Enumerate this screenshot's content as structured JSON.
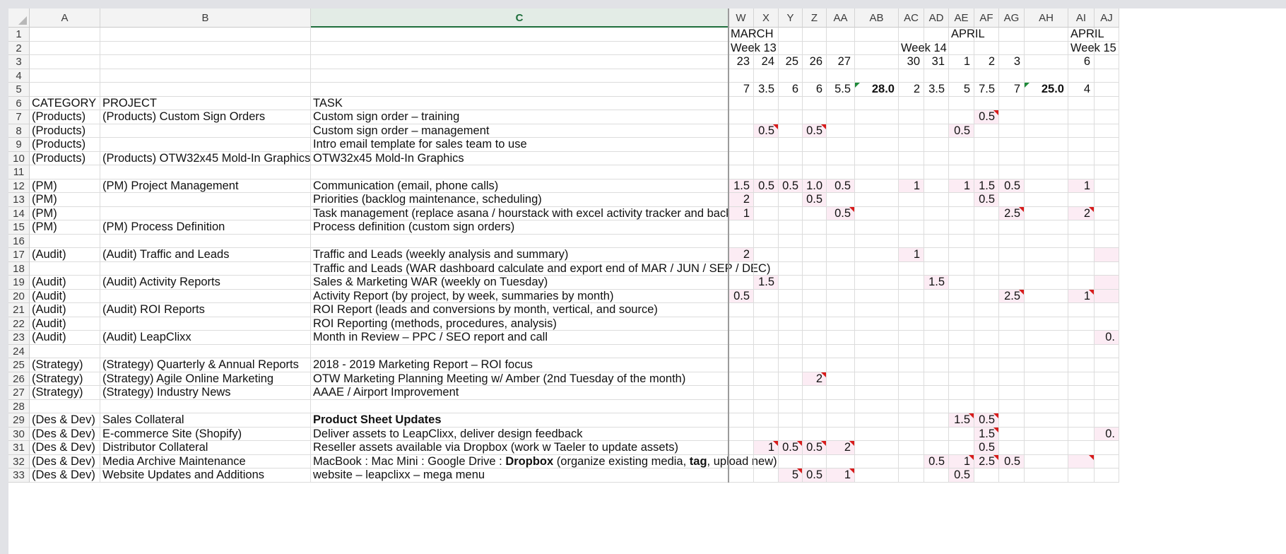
{
  "columns": [
    "A",
    "B",
    "C",
    "W",
    "X",
    "Y",
    "Z",
    "AA",
    "AB",
    "AC",
    "AD",
    "AE",
    "AF",
    "AG",
    "AH",
    "AI",
    "AJ"
  ],
  "selected_column": "C",
  "rows": [
    {
      "n": "1",
      "cells": {
        "W": "MARCH",
        "AE": "APRIL",
        "AI": "APRIL"
      }
    },
    {
      "n": "2",
      "cells": {
        "W": "Week 13",
        "AC": "Week 14",
        "AI": "Week 15"
      }
    },
    {
      "n": "3",
      "cells": {
        "W": "23",
        "X": "24",
        "Y": "25",
        "Z": "26",
        "AA": "27",
        "AC": "30",
        "AD": "31",
        "AE": "1",
        "AF": "2",
        "AG": "3",
        "AI": "6"
      }
    },
    {
      "n": "4",
      "cells": {}
    },
    {
      "n": "5",
      "cells": {
        "W": "7",
        "X": "3.5",
        "Y": "6",
        "Z": "6",
        "AA": "5.5",
        "AB": "28.0",
        "AC": "2",
        "AD": "3.5",
        "AE": "5",
        "AF": "7.5",
        "AG": "7",
        "AH": "25.0",
        "AI": "4"
      }
    },
    {
      "n": "6",
      "cells": {
        "A": "CATEGORY",
        "B": "PROJECT",
        "C": "TASK"
      }
    },
    {
      "n": "7",
      "cells": {
        "A": "(Products)",
        "B": "(Products) Custom Sign Orders",
        "C": "Custom sign order – training",
        "AF": "0.5"
      }
    },
    {
      "n": "8",
      "cells": {
        "A": "(Products)",
        "C": "Custom sign order – management",
        "X": "0.5",
        "Z": "0.5",
        "AE": "0.5"
      }
    },
    {
      "n": "9",
      "cells": {
        "A": "(Products)",
        "C": "Intro email template for sales team to use"
      }
    },
    {
      "n": "10",
      "cells": {
        "A": "(Products)",
        "B": "(Products) OTW32x45 Mold-In Graphics",
        "C": "OTW32x45 Mold-In Graphics"
      }
    },
    {
      "n": "11",
      "cells": {}
    },
    {
      "n": "12",
      "cells": {
        "A": "(PM)",
        "B": "(PM) Project Management",
        "C": "Communication (email, phone calls)",
        "W": "1.5",
        "X": "0.5",
        "Y": "0.5",
        "Z": "1.0",
        "AA": "0.5",
        "AC": "1",
        "AE": "1",
        "AF": "1.5",
        "AG": "0.5",
        "AI": "1"
      }
    },
    {
      "n": "13",
      "cells": {
        "A": "(PM)",
        "C": "Priorities (backlog maintenance, scheduling)",
        "W": "2",
        "Z": "0.5",
        "AF": "0.5"
      }
    },
    {
      "n": "14",
      "cells": {
        "A": "(PM)",
        "C": "Task management (replace asana / hourstack with excel activity tracker and backlog )",
        "W": "1",
        "AA": "0.5",
        "AG": "2.5",
        "AI": "2"
      }
    },
    {
      "n": "15",
      "cells": {
        "A": "(PM)",
        "B": "(PM) Process Definition",
        "C": "Process definition (custom sign orders)"
      }
    },
    {
      "n": "16",
      "cells": {}
    },
    {
      "n": "17",
      "cells": {
        "A": "(Audit)",
        "B": "(Audit) Traffic and Leads",
        "C": "Traffic and Leads (weekly analysis and summary)",
        "W": "2",
        "AC": "1"
      }
    },
    {
      "n": "18",
      "cells": {
        "C": "Traffic and Leads (WAR dashboard calculate and export end of MAR / JUN / SEP / DEC)"
      }
    },
    {
      "n": "19",
      "cells": {
        "A": "(Audit)",
        "B": "(Audit) Activity Reports",
        "C": "Sales & Marketing WAR (weekly on Tuesday)",
        "X": "1.5",
        "AD": "1.5"
      }
    },
    {
      "n": "20",
      "cells": {
        "A": "(Audit)",
        "C": "Activity Report (by project, by week, summaries by month)",
        "W": "0.5",
        "AG": "2.5",
        "AI": "1"
      }
    },
    {
      "n": "21",
      "cells": {
        "A": "(Audit)",
        "B": "(Audit) ROI Reports",
        "C": "ROI Report (leads and conversions by month, vertical, and source)"
      }
    },
    {
      "n": "22",
      "cells": {
        "A": "(Audit)",
        "C": "ROI Reporting (methods, procedures, analysis)"
      }
    },
    {
      "n": "23",
      "cells": {
        "A": "(Audit)",
        "B": "(Audit) LeapClixx",
        "C": "Month in Review – PPC / SEO report and call",
        "AJ": "0."
      }
    },
    {
      "n": "24",
      "cells": {}
    },
    {
      "n": "25",
      "cells": {
        "A": "(Strategy)",
        "B": "(Strategy) Quarterly & Annual Reports",
        "C": "2018 - 2019 Marketing Report – ROI focus"
      }
    },
    {
      "n": "26",
      "cells": {
        "A": "(Strategy)",
        "B": "(Strategy) Agile Online Marketing",
        "C": "OTW Marketing Planning Meeting w/ Amber (2nd Tuesday of the month)",
        "Z": "2"
      }
    },
    {
      "n": "27",
      "cells": {
        "A": "(Strategy)",
        "B": "(Strategy) Industry News",
        "C": "AAAE / Airport Improvement"
      }
    },
    {
      "n": "28",
      "cells": {}
    },
    {
      "n": "29",
      "cells": {
        "A": "(Des & Dev)",
        "B": "Sales Collateral",
        "C": "Product Sheet Updates",
        "AE": "1.5",
        "AF": "0.5"
      }
    },
    {
      "n": "30",
      "cells": {
        "A": "(Des & Dev)",
        "B": "E-commerce Site (Shopify)",
        "C": "Deliver assets to LeapClixx, deliver design feedback",
        "AF": "1.5",
        "AJ": "0."
      }
    },
    {
      "n": "31",
      "cells": {
        "A": "(Des & Dev)",
        "B": "Distributor Collateral",
        "C": "Reseller assets available via Dropbox (work w Taeler to update assets)",
        "X": "1",
        "Y": "0.5",
        "Z": "0.5",
        "AA": "2",
        "AF": "0.5"
      }
    },
    {
      "n": "32",
      "cells": {
        "A": "(Des & Dev)",
        "B": "Media Archive Maintenance",
        "C": "MacBook : Mac Mini : Google Drive : Dropbox (organize existing media, tag, upload new)",
        "AD": "0.5",
        "AE": "1",
        "AF": "2.5",
        "AG": "0.5"
      }
    },
    {
      "n": "33",
      "cells": {
        "A": "(Des & Dev)",
        "B": "Website Updates and Additions",
        "C": "website – leapclixx – mega menu",
        "Y": "5",
        "Z": "0.5",
        "AA": "1",
        "AE": "0.5"
      }
    }
  ],
  "colors": {
    "accent": "#1e6e3c",
    "pink": "#fcecf4",
    "note_red": "#d81b1b",
    "note_green": "#1f8a3a"
  }
}
